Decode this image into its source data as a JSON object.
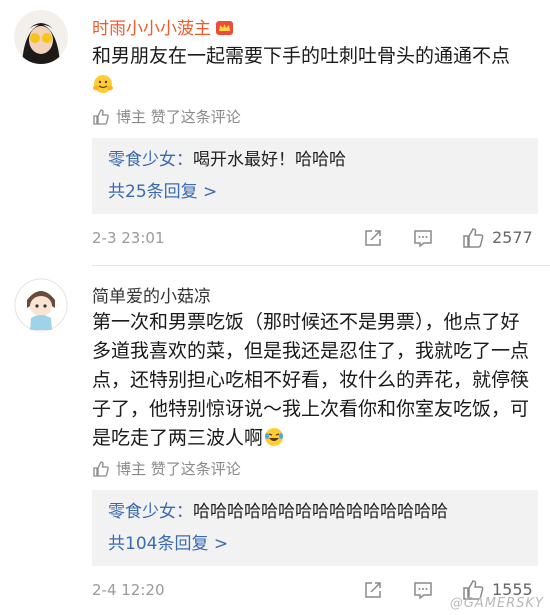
{
  "comments": [
    {
      "username": "时雨小小小菠主",
      "username_color": "#f05a2a",
      "text": "和男朋友在一起需要下手的吐刺吐骨头的通通不点",
      "liked_by": "博主 赞了这条评论",
      "reply": {
        "user": "零食少女",
        "sep": "：",
        "text": "喝开水最好！哈哈哈",
        "more": "共25条回复 >"
      },
      "timestamp": "2-3 23:01",
      "likes": "2577"
    },
    {
      "username": "简单爱的小菇凉",
      "username_color": "#333333",
      "text": "第一次和男票吃饭（那时候还不是男票），他点了好多道我喜欢的菜，但是我还是忍住了，我就吃了一点点，还特别担心吃相不好看，妆什么的弄花，就停筷子了，他特别惊讶说～我上次看你和你室友吃饭，可是吃走了两三波人啊",
      "liked_by": "博主 赞了这条评论",
      "reply": {
        "user": "零食少女",
        "sep": "：",
        "text": "哈哈哈哈哈哈哈哈哈哈哈哈哈哈哈",
        "more": "共104条回复 >"
      },
      "timestamp": "2-4 12:20",
      "likes": "1555"
    }
  ],
  "watermark": "@GAMERSKY",
  "colors": {
    "link": "#3a6bb0",
    "meta": "#9a9a9a"
  }
}
